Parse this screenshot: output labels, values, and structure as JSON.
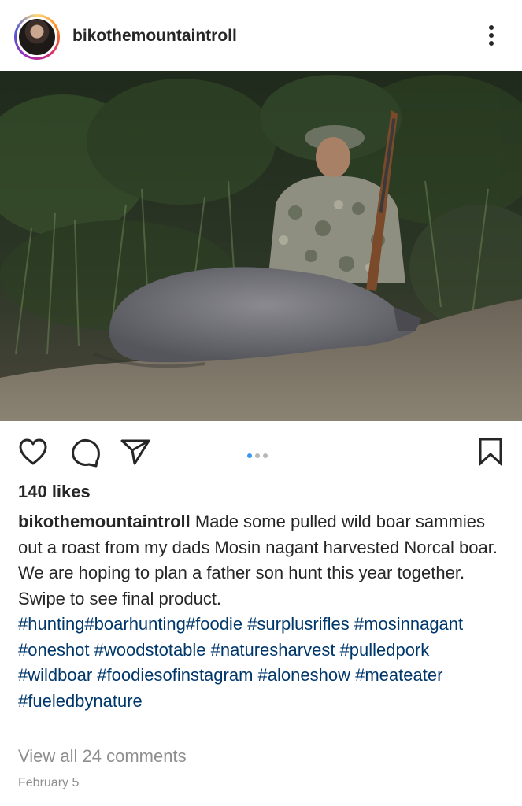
{
  "post": {
    "username": "bikothemountaintroll",
    "likes": "140 likes",
    "caption_user": "bikothemountaintroll",
    "caption_text": "Made some pulled wild  boar sammies out a roast from my dads Mosin nagant harvested Norcal boar. We are hoping to plan a father son hunt this year together.  Swipe to see final product.",
    "hashtags": [
      "#hunting",
      "#boarhunting",
      "#foodie",
      "#surplusrifles",
      "#mosinnagant",
      "#oneshot",
      "#woodstotable",
      "#naturesharvest",
      "#pulledpork",
      "#wildboar",
      "#foodiesofinstagram",
      "#aloneshow",
      "#meateater",
      "#fueledbynature"
    ],
    "view_comments": "View all 24 comments",
    "date": "February 5"
  },
  "carousel": {
    "count": 3,
    "active_index": 0
  },
  "icons": {
    "more": "more-vertical-icon",
    "like": "heart-icon",
    "comment": "comment-icon",
    "share": "send-icon",
    "save": "bookmark-icon"
  },
  "colors": {
    "text": "#262626",
    "link": "#00376b",
    "muted": "#8e8e8e",
    "active_dot": "#3897f0"
  }
}
